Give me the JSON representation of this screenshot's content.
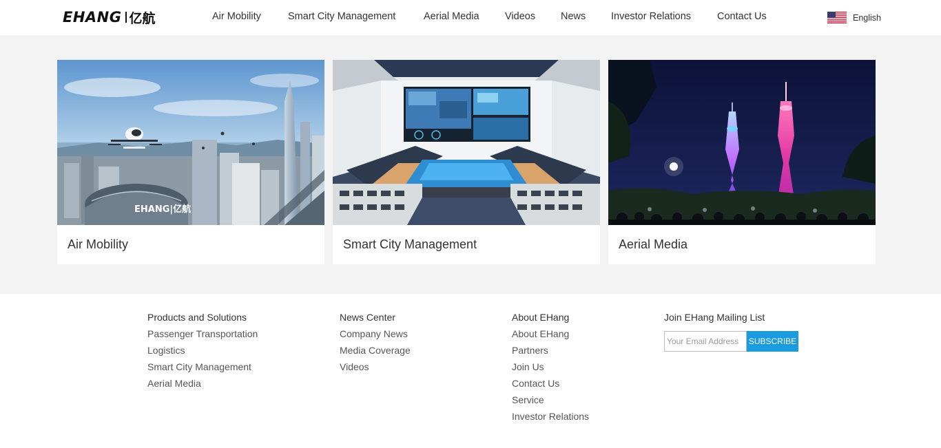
{
  "header": {
    "logo_en": "EHANG",
    "logo_cn": "亿航",
    "nav": [
      {
        "label": "Air Mobility"
      },
      {
        "label": "Smart City Management"
      },
      {
        "label": "Aerial Media"
      },
      {
        "label": "Videos"
      },
      {
        "label": "News"
      },
      {
        "label": "Investor Relations"
      },
      {
        "label": "Contact Us"
      }
    ],
    "language": "English",
    "language_icon": "us-flag-icon"
  },
  "cards": [
    {
      "label": "Air Mobility",
      "image": "air-mobility-city-image",
      "image_text": "EHANG|亿航"
    },
    {
      "label": "Smart City Management",
      "image": "command-center-image"
    },
    {
      "label": "Aerial Media",
      "image": "canton-tower-night-image"
    }
  ],
  "footer": {
    "columns": [
      {
        "title": "Products and Solutions",
        "links": [
          "Passenger Transportation",
          "Logistics",
          "Smart City Management",
          "Aerial Media"
        ]
      },
      {
        "title": "News Center",
        "links": [
          "Company News",
          "Media Coverage",
          "Videos"
        ]
      },
      {
        "title": "About EHang",
        "links": [
          "About EHang",
          "Partners",
          "Join Us",
          "Contact Us",
          "Service",
          "Investor Relations"
        ]
      }
    ],
    "mailing": {
      "title": "Join EHang Mailing List",
      "placeholder": "Your Email Address",
      "button": "SUBSCRIBE"
    }
  },
  "colors": {
    "page_bg": "#f3f3f3",
    "subscribe_button": "#1a9bde",
    "text": "#333333"
  }
}
